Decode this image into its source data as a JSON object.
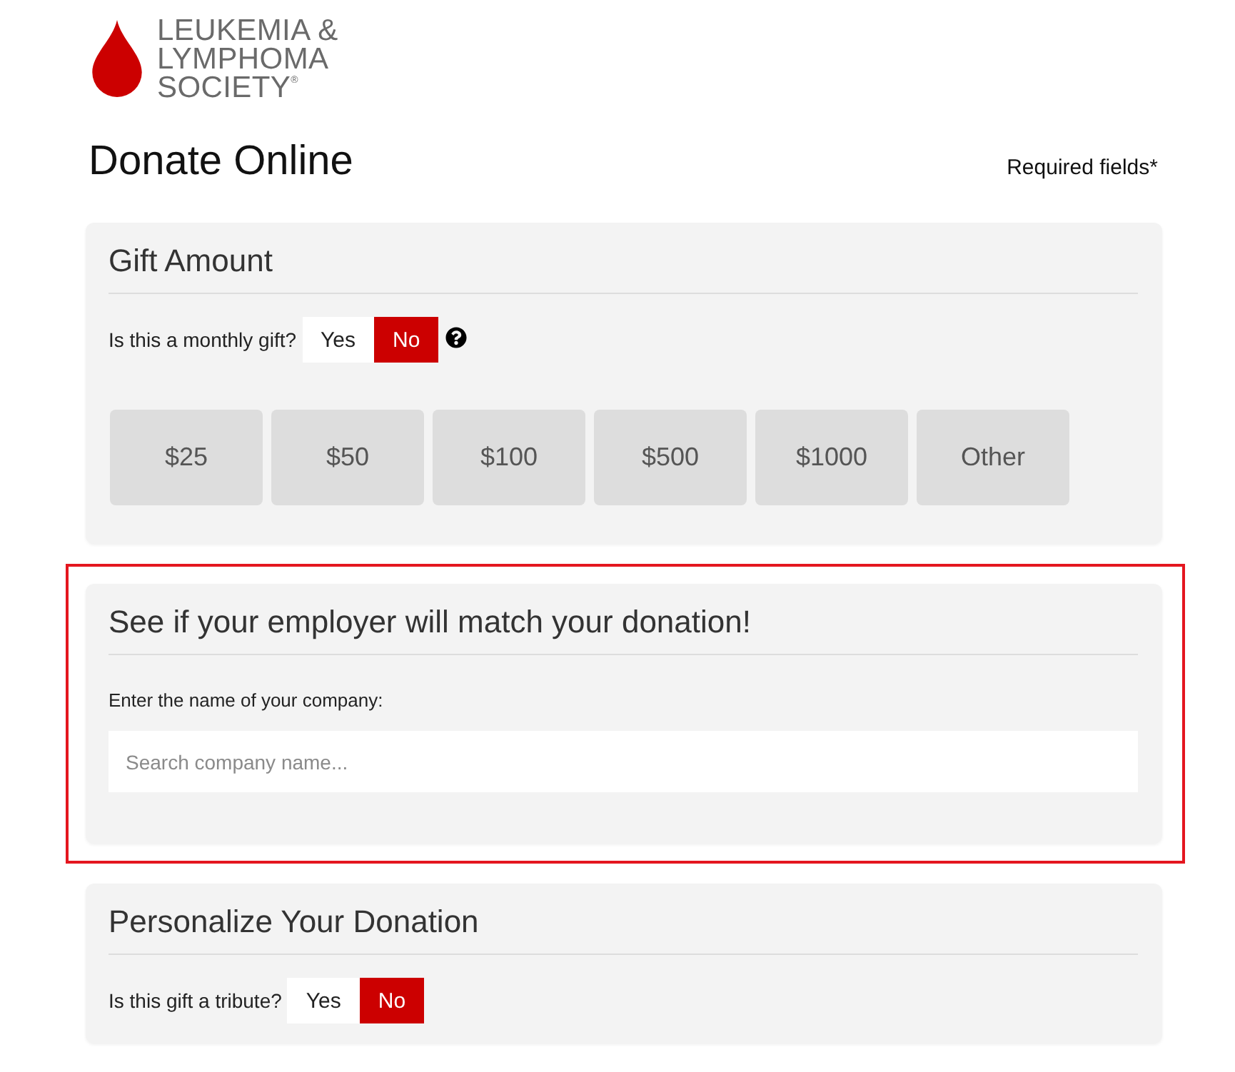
{
  "logo": {
    "lines": [
      "LEUKEMIA &",
      "LYMPHOMA",
      "SOCIETY$^{®}$"
    ]
  },
  "header": {
    "title": "Donate Online",
    "required_note": "Required fields*"
  },
  "sections": [
    {
      "title": "Gift Amount",
      "highlighted": false,
      "question": {
        "label": "Is this a monthly gift?",
        "help_icon": true,
        "options": [
          {
            "label": "Yes",
            "selected": false
          },
          {
            "label": "No",
            "selected": true
          }
        ]
      },
      "amounts": [
        {
          "label": "$25",
          "selected": false
        },
        {
          "label": "$50",
          "selected": false
        },
        {
          "label": "$100",
          "selected": false
        },
        {
          "label": "$500",
          "selected": false
        },
        {
          "label": "$1000",
          "selected": false
        },
        {
          "label": "Other",
          "selected": false
        }
      ]
    },
    {
      "title": "See if your employer will match your donation!",
      "highlighted": true,
      "field": {
        "label": "Enter the name of your company:",
        "placeholder": "Search company name..."
      }
    },
    {
      "title": "Personalize Your Donation",
      "highlighted": false,
      "question": {
        "label": "Is this gift a tribute?",
        "help_icon": false,
        "options": [
          {
            "label": "Yes",
            "selected": false
          },
          {
            "label": "No",
            "selected": true
          }
        ]
      }
    }
  ]
}
